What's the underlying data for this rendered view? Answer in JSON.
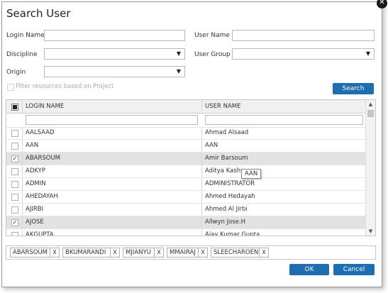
{
  "dialog": {
    "title": "Search User",
    "close_glyph": "✕"
  },
  "form": {
    "login_name_label": "Login Name",
    "user_name_label": "User Name",
    "discipline_label": "Discipline",
    "user_group_label": "User Group",
    "origin_label": "Origin",
    "login_name_value": "",
    "user_name_value": "",
    "discipline_value": "",
    "user_group_value": "",
    "origin_value": "",
    "dropdown_glyph": "▼",
    "filter_label": "Filter resources based on Project",
    "search_button": "Search"
  },
  "grid": {
    "columns": [
      "LOGIN NAME",
      "USER NAME"
    ],
    "rows": [
      {
        "login": "AALSAAD",
        "user": "Ahmad Alsaad",
        "checked": false
      },
      {
        "login": "AAN",
        "user": "AAN",
        "checked": false
      },
      {
        "login": "ABARSOUM",
        "user": "Amir Barsoum",
        "checked": true
      },
      {
        "login": "ADKYP",
        "user": "Aditya Kashy",
        "checked": false
      },
      {
        "login": "ADMIN",
        "user": "ADMINISTRATOR",
        "checked": false
      },
      {
        "login": "AHEDAYAH",
        "user": "Ahmed Hedayah",
        "checked": false
      },
      {
        "login": "AJIRBI",
        "user": "Ahmed Al Jirbi",
        "checked": false
      },
      {
        "login": "AJOSE",
        "user": "Allwyn Jose.H",
        "checked": true
      },
      {
        "login": "AKGUPTA",
        "user": "Ajay Kumar Gupta",
        "checked": false
      }
    ],
    "check_glyph": "✓",
    "tooltip": "AAN",
    "scroll_up": "▲",
    "scroll_down": "▼"
  },
  "selected_tags": [
    "ABARSOUM",
    "BKUMARANDI",
    "MJIANYU",
    "MMAIRAJ",
    "SLEECHAROEN"
  ],
  "tag_remove_glyph": "X",
  "footer": {
    "ok": "OK",
    "cancel": "Cancel"
  },
  "colors": {
    "accent": "#1d6fb2",
    "selected_row": "#e2e2e2"
  }
}
